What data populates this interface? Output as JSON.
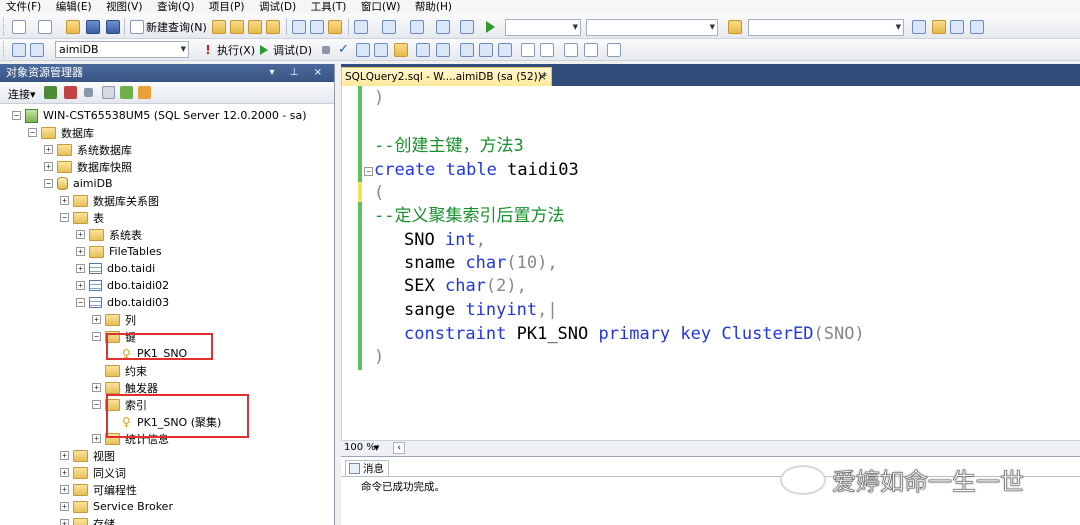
{
  "menu": {
    "items": [
      "文件(F)",
      "编辑(E)",
      "视图(V)",
      "查询(Q)",
      "项目(P)",
      "调试(D)",
      "工具(T)",
      "窗口(W)",
      "帮助(H)"
    ]
  },
  "toolbar": {
    "new_query_label": "新建查询(N)",
    "database_selector": "aimiDB",
    "execute_label": "执行(X)",
    "debug_label": "调试(D)"
  },
  "object_explorer": {
    "title": "对象资源管理器",
    "header_buttons": "▾ ⊥ ×",
    "connect_label": "连接▾",
    "tree": [
      {
        "label": "WIN-CST65538UM5 (SQL Server 12.0.2000 - sa)",
        "expander": "−",
        "icon": "server-icon"
      },
      {
        "label": "数据库",
        "expander": "−",
        "icon": "folder-icon"
      },
      {
        "label": "系统数据库",
        "expander": "+",
        "icon": "folder-icon"
      },
      {
        "label": "数据库快照",
        "expander": "+",
        "icon": "folder-icon"
      },
      {
        "label": "aimiDB",
        "expander": "−",
        "icon": "database-icon"
      },
      {
        "label": "数据库关系图",
        "expander": "+",
        "icon": "folder-icon"
      },
      {
        "label": "表",
        "expander": "−",
        "icon": "folder-icon"
      },
      {
        "label": "系统表",
        "expander": "+",
        "icon": "folder-icon"
      },
      {
        "label": "FileTables",
        "expander": "+",
        "icon": "folder-icon"
      },
      {
        "label": "dbo.taidi",
        "expander": "+",
        "icon": "table-icon"
      },
      {
        "label": "dbo.taidi02",
        "expander": "+",
        "icon": "table-icon"
      },
      {
        "label": "dbo.taidi03",
        "expander": "−",
        "icon": "table-icon"
      },
      {
        "label": "列",
        "expander": "+",
        "icon": "folder-icon"
      },
      {
        "label": "键",
        "expander": "−",
        "icon": "folder-icon"
      },
      {
        "label": "PK1_SNO",
        "expander": "",
        "icon": "key-icon"
      },
      {
        "label": "约束",
        "expander": "",
        "icon": "folder-icon"
      },
      {
        "label": "触发器",
        "expander": "+",
        "icon": "folder-icon"
      },
      {
        "label": "索引",
        "expander": "−",
        "icon": "folder-icon"
      },
      {
        "label": "PK1_SNO (聚集)",
        "expander": "",
        "icon": "key-icon"
      },
      {
        "label": "统计信息",
        "expander": "+",
        "icon": "folder-icon"
      },
      {
        "label": "视图",
        "expander": "+",
        "icon": "folder-icon"
      },
      {
        "label": "同义词",
        "expander": "+",
        "icon": "folder-icon"
      },
      {
        "label": "可编程性",
        "expander": "+",
        "icon": "folder-icon"
      },
      {
        "label": "Service Broker",
        "expander": "+",
        "icon": "folder-icon"
      },
      {
        "label": "存储",
        "expander": "+",
        "icon": "folder-icon"
      }
    ]
  },
  "editor": {
    "tab_title": "SQLQuery2.sql - W....aimiDB (sa (52))*",
    "tab_close": "×",
    "code": {
      "l1": ")",
      "l2": "--创建主键，方法3",
      "l3_kw1": "create",
      "l3_kw2": "table",
      "l3_name": "taidi03",
      "l4": "(",
      "l5": "--定义聚集索引后置方法",
      "l6_col": "SNO",
      "l6_type": "int",
      "l6_end": ",",
      "l7_col": "sname",
      "l7_type": "char",
      "l7_args": "(10),",
      "l8_col": "SEX",
      "l8_type": "char",
      "l8_args": "(2),",
      "l9_col": "sange",
      "l9_type": "tinyint",
      "l9_end": ",|",
      "l10_kw1": "constraint",
      "l10_name": "PK1_SNO",
      "l10_kw2": "primary key",
      "l10_kw3": "ClusterED",
      "l10_args": "(SNO)",
      "l11": ")"
    },
    "zoom": "100 %",
    "results_tab": "消息",
    "result_message": "命令已成功完成。"
  },
  "watermark": {
    "text": "爱婷如命一生一世"
  },
  "colors": {
    "keyword": "#1d36e0",
    "comment": "#16922a",
    "highlight_box": "#e03030",
    "panel_header": "#385482"
  }
}
